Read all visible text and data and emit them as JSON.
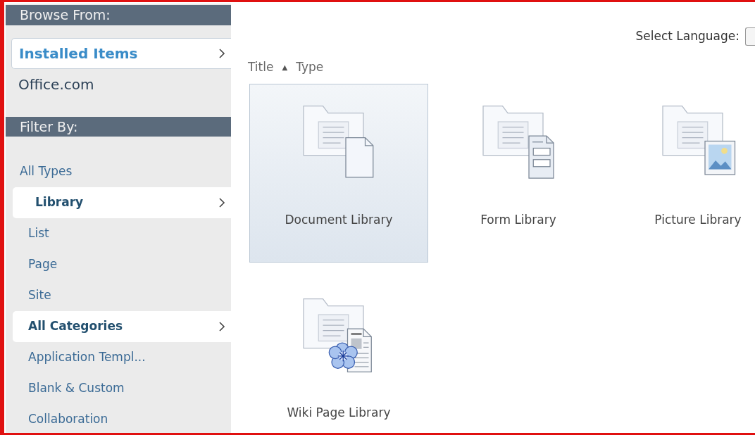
{
  "sidebar": {
    "sections": [
      {
        "header": "Browse From:",
        "items": [
          {
            "label": "Installed Items",
            "selected": true
          },
          {
            "label": "Office.com",
            "selected": false
          }
        ]
      },
      {
        "header": "Filter By:",
        "items": [
          {
            "label": "All Types",
            "selected": false
          },
          {
            "label": "Library",
            "selected": true
          },
          {
            "label": "List",
            "selected": false
          },
          {
            "label": "Page",
            "selected": false
          },
          {
            "label": "Site",
            "selected": false
          }
        ]
      },
      {
        "items": [
          {
            "label": "All Categories",
            "selected": true
          },
          {
            "label": "Application Templ...",
            "selected": false
          },
          {
            "label": "Blank & Custom",
            "selected": false
          },
          {
            "label": "Collaboration",
            "selected": false
          }
        ]
      }
    ]
  },
  "language": {
    "label": "Select Language:"
  },
  "sort": {
    "columns": [
      {
        "label": "Title",
        "arrow": "▲"
      },
      {
        "label": "Type"
      }
    ]
  },
  "tiles": [
    {
      "label": "Document Library",
      "kind": "document",
      "selected": true
    },
    {
      "label": "Form Library",
      "kind": "form",
      "selected": false
    },
    {
      "label": "Picture Library",
      "kind": "picture",
      "selected": false
    },
    {
      "label": "Wiki Page Library",
      "kind": "wiki",
      "selected": false
    }
  ]
}
